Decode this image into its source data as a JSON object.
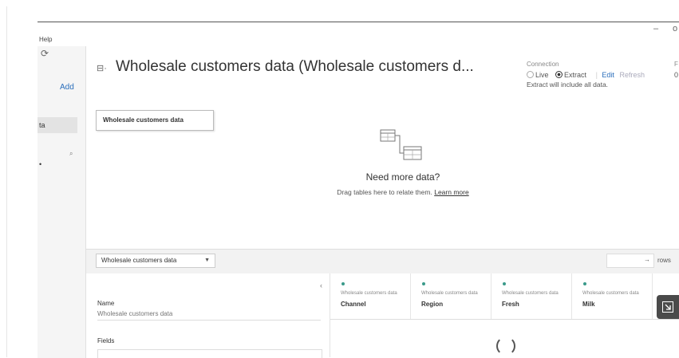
{
  "menu": {
    "help": "Help"
  },
  "window_controls": {
    "minimize": "–",
    "restore": "o"
  },
  "sidebar": {
    "refresh_glyph": "⟳",
    "add_label": "Add",
    "item_label": "ta",
    "search_glyph": "⌕",
    "dot": "•"
  },
  "datasource": {
    "title": "Wholesale customers data (Wholesale customers d...",
    "title_icon": "⊟·"
  },
  "connection": {
    "label": "Connection",
    "live": "Live",
    "extract": "Extract",
    "edit": "Edit",
    "refresh": "Refresh",
    "note": "Extract will include all data.",
    "selected": "extract"
  },
  "filters": {
    "label": "F",
    "count": "0"
  },
  "canvas": {
    "table_name": "Wholesale customers data",
    "need_more": "Need more data?",
    "drag_text": "Drag tables here to relate them.",
    "learn_more": "Learn more"
  },
  "bottom_bar": {
    "table_select": "Wholesale customers data",
    "rows_label": "rows",
    "rows_arrow": "→"
  },
  "meta": {
    "collapse_glyph": "‹",
    "name_label": "Name",
    "name_value": "Wholesale customers data",
    "fields_label": "Fields"
  },
  "columns": [
    {
      "source": "Wholesale customers data",
      "name": "Channel"
    },
    {
      "source": "Wholesale customers data",
      "name": "Region"
    },
    {
      "source": "Wholesale customers data",
      "name": "Fresh"
    },
    {
      "source": "Wholesale customers data",
      "name": "Milk"
    }
  ],
  "icons": {
    "accent_teal": "#3a9a8a",
    "link_blue": "#2a6ebb"
  }
}
